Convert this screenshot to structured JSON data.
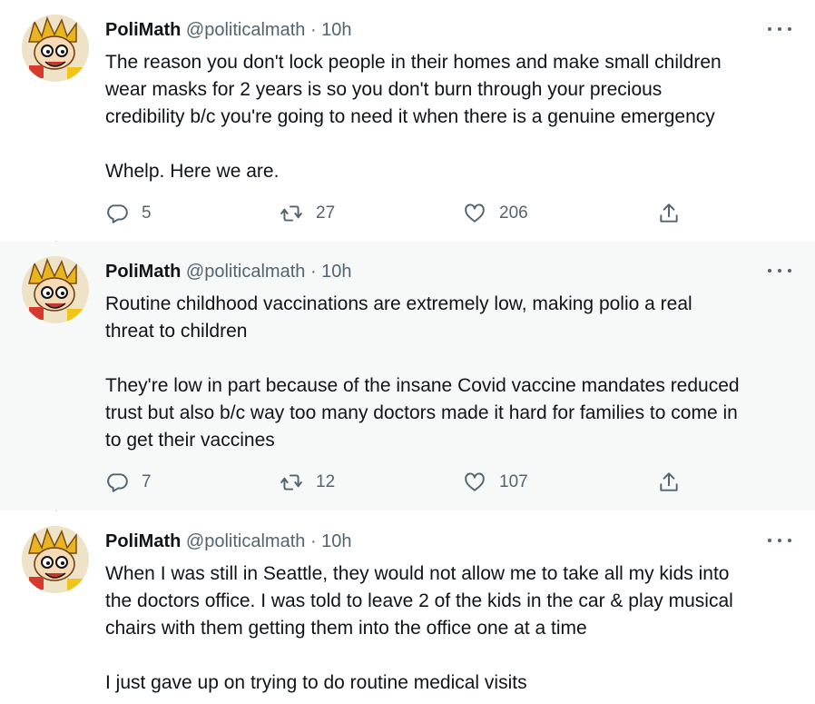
{
  "tweets": [
    {
      "name": "PoliMath",
      "handle": "@politicalmath",
      "dot": "·",
      "time": "10h",
      "text": "The reason you don't lock people in their homes and make small children\nwear masks for 2 years is so you don't burn through your precious\ncredibility b/c you're going to need it when there is a genuine emergency\n\nWhelp. Here we are.",
      "replies": "5",
      "retweets": "27",
      "likes": "206"
    },
    {
      "name": "PoliMath",
      "handle": "@politicalmath",
      "dot": "·",
      "time": "10h",
      "text": "Routine childhood vaccinations are extremely low, making polio a real\nthreat to children\n\nThey're low in part because of the insane Covid vaccine mandates reduced\ntrust but also b/c way too many doctors made it hard for families to come in\nto get their vaccines",
      "replies": "7",
      "retweets": "12",
      "likes": "107"
    },
    {
      "name": "PoliMath",
      "handle": "@politicalmath",
      "dot": "·",
      "time": "10h",
      "text": "When I was still in Seattle, they would not allow me to take all my kids into\nthe doctors office. I was told to leave 2 of the kids in the car & play musical\nchairs with them getting them into the office one at a time\n\nI just gave up on trying to do routine medical visits"
    }
  ],
  "colors": {
    "text": "#0f1419",
    "secondary": "#536471",
    "thread_line": "#cfd9de",
    "highlight_bg": "#f7f9f9"
  },
  "icons": {
    "reply": "speech-bubble-icon",
    "retweet": "retweet-arrows-icon",
    "like": "heart-outline-icon",
    "share": "share-upload-icon",
    "more": "more-horizontal-icon"
  }
}
